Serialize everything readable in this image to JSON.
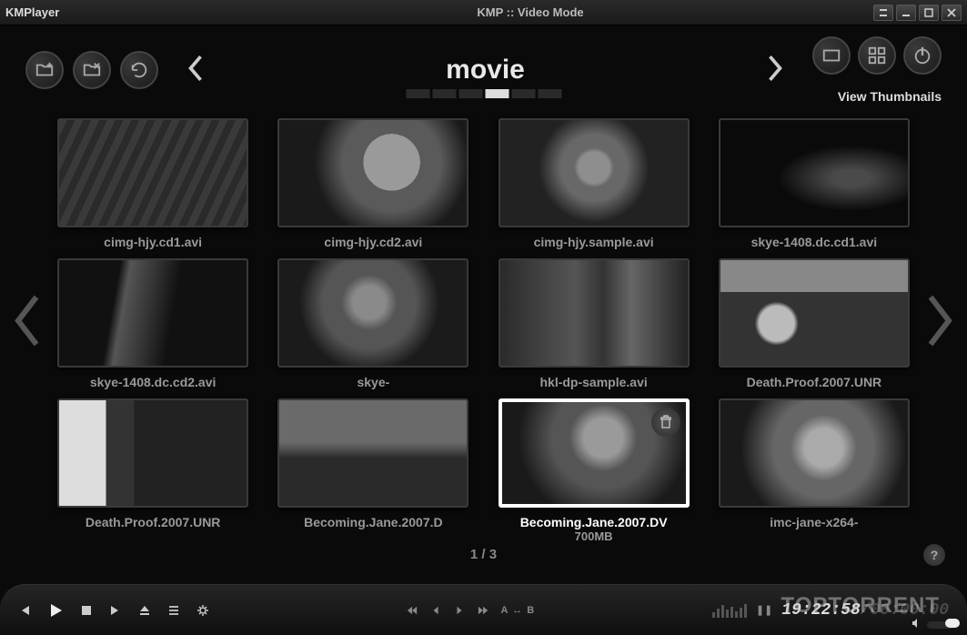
{
  "titlebar": {
    "app_name": "KMPlayer",
    "mode_title": "KMP :: Video Mode"
  },
  "toolbar": {
    "category": "movie",
    "view_label": "View Thumbnails"
  },
  "progress": {
    "active_index": 3,
    "count": 6
  },
  "pagination": {
    "text": "1 / 3"
  },
  "help": {
    "label": "?"
  },
  "selected": {
    "size": "700MB"
  },
  "thumbnails": [
    {
      "label": "cimg-hjy.cd1.avi",
      "tex": "tex1"
    },
    {
      "label": "cimg-hjy.cd2.avi",
      "tex": "tex2"
    },
    {
      "label": "cimg-hjy.sample.avi",
      "tex": "tex3"
    },
    {
      "label": "skye-1408.dc.cd1.avi",
      "tex": "tex4"
    },
    {
      "label": "skye-1408.dc.cd2.avi",
      "tex": "tex5"
    },
    {
      "label": "skye-",
      "tex": "tex6"
    },
    {
      "label": "hkl-dp-sample.avi",
      "tex": "tex7"
    },
    {
      "label": "Death.Proof.2007.UNR",
      "tex": "tex8"
    },
    {
      "label": "Death.Proof.2007.UNR",
      "tex": "tex9"
    },
    {
      "label": "Becoming.Jane.2007.D",
      "tex": "tex10"
    },
    {
      "label": "Becoming.Jane.2007.DV",
      "tex": "tex11",
      "selected": true
    },
    {
      "label": "imc-jane-x264-",
      "tex": "tex12"
    }
  ],
  "playback": {
    "ab_label": "A ↔ B",
    "time_current": "19:22:58",
    "time_total": "00:00:00",
    "pause_glyph": "❚❚"
  },
  "watermark": "TOPTORRENT"
}
